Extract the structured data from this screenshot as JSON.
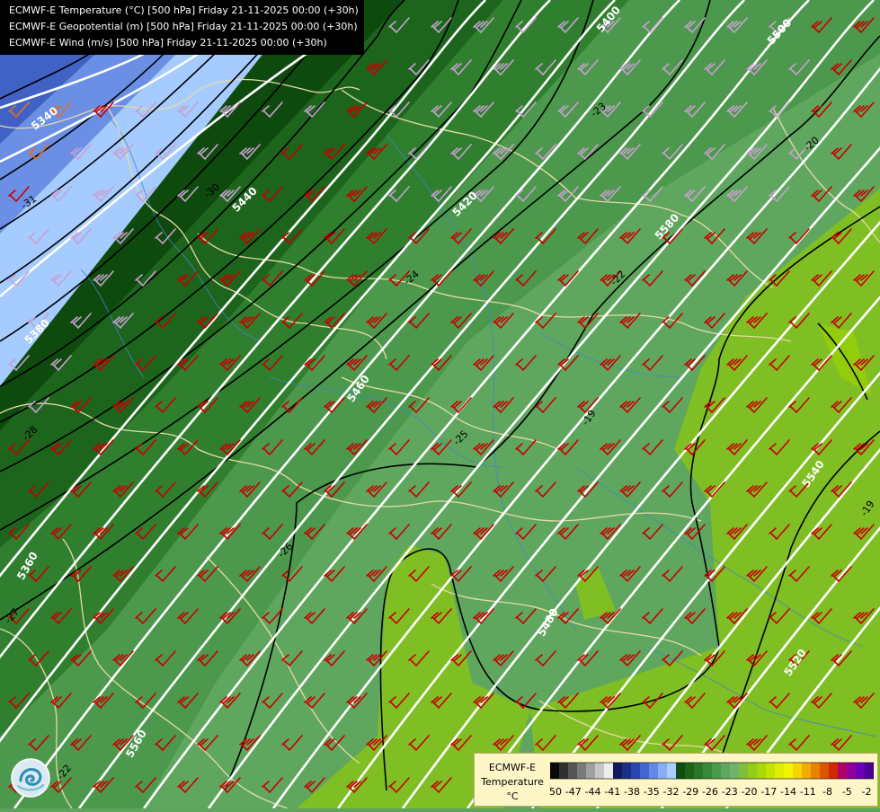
{
  "legend": {
    "lines": [
      "ECMWF-E Temperature (°C) [500 hPa] Friday 21-11-2025 00:00 (+30h)",
      "ECMWF-E Geopotential (m) [500 hPa] Friday 21-11-2025 00:00 (+30h)",
      "ECMWF-E Wind (m/s) [500 hPa] Friday 21-11-2025 00:00 (+30h)"
    ]
  },
  "colorbar": {
    "title_lines": [
      "ECMWF-E",
      "Temperature",
      "°C"
    ],
    "tick_labels": [
      "-50",
      "-47",
      "-44",
      "-41",
      "-38",
      "-35",
      "-32",
      "-29",
      "-26",
      "-23",
      "-20",
      "-17",
      "-14",
      "-11",
      "-8",
      "-5",
      "-2"
    ],
    "colors": [
      "#0a0a0a",
      "#303030",
      "#555555",
      "#7a7a7a",
      "#a0a0a0",
      "#c6c6c6",
      "#ededed",
      "#101a5a",
      "#1c2f86",
      "#2c46ad",
      "#4666cf",
      "#6388e6",
      "#86aef6",
      "#a9ceff",
      "#114d11",
      "#1b621b",
      "#287628",
      "#388a38",
      "#4b9a4b",
      "#5ea85e",
      "#6fb36f",
      "#7fbf3a",
      "#94cc19",
      "#aad80a",
      "#c4e400",
      "#deee00",
      "#f2f400",
      "#f6d400",
      "#f3ad00",
      "#e98300",
      "#dc5600",
      "#cf2a00",
      "#b0006a",
      "#8e009a",
      "#6c00b8",
      "#4c0094"
    ]
  },
  "isohypse_labels": [
    "5340",
    "5360",
    "5380",
    "5400",
    "5420",
    "5440",
    "5460",
    "5480",
    "5500",
    "5520",
    "5540",
    "5560",
    "5580"
  ],
  "isotherm_labels": [
    "-34",
    "-31",
    "-30",
    "-28",
    "-27",
    "-26",
    "-25",
    "-24",
    "-23",
    "-22",
    "-21",
    "-20",
    "-19"
  ],
  "colors": {
    "geopotential_contour": "#ffffff",
    "isotherm": "#000000",
    "wind_barb_main": "#c80000",
    "wind_barb_cold": "#c8a0d0",
    "wind_barb_orange": "#e07020",
    "border": "#e6d9a6",
    "river": "#3f86c6"
  }
}
